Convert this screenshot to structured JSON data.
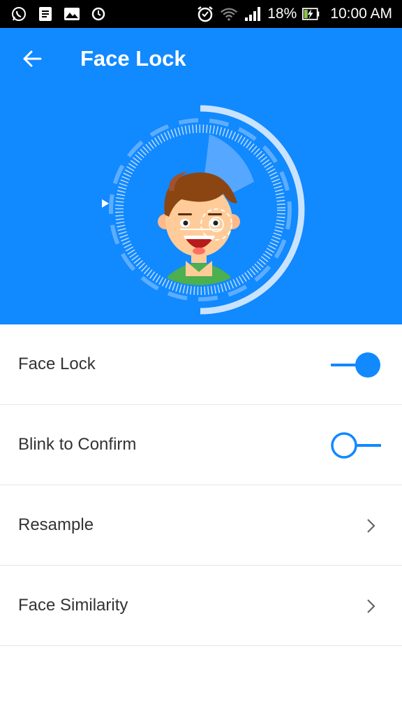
{
  "status_bar": {
    "icons_left": [
      "whatsapp-icon",
      "notes-icon",
      "gallery-icon",
      "sync-icon"
    ],
    "icons_right": [
      "alarm-icon",
      "wifi-icon",
      "signal-icon",
      "battery-charging-icon"
    ],
    "battery": "18%",
    "time": "10:00 AM"
  },
  "header": {
    "title": "Face Lock",
    "back_icon": "arrow-left-icon",
    "background_color": "#1189ff"
  },
  "settings": [
    {
      "label": "Face Lock",
      "control": "toggle",
      "on": true
    },
    {
      "label": "Blink to Confirm",
      "control": "toggle",
      "on": false
    },
    {
      "label": "Resample",
      "control": "chevron"
    },
    {
      "label": "Face Similarity",
      "control": "chevron"
    }
  ],
  "colors": {
    "accent": "#1189ff",
    "text": "#333333",
    "divider": "#e6e6e6"
  }
}
